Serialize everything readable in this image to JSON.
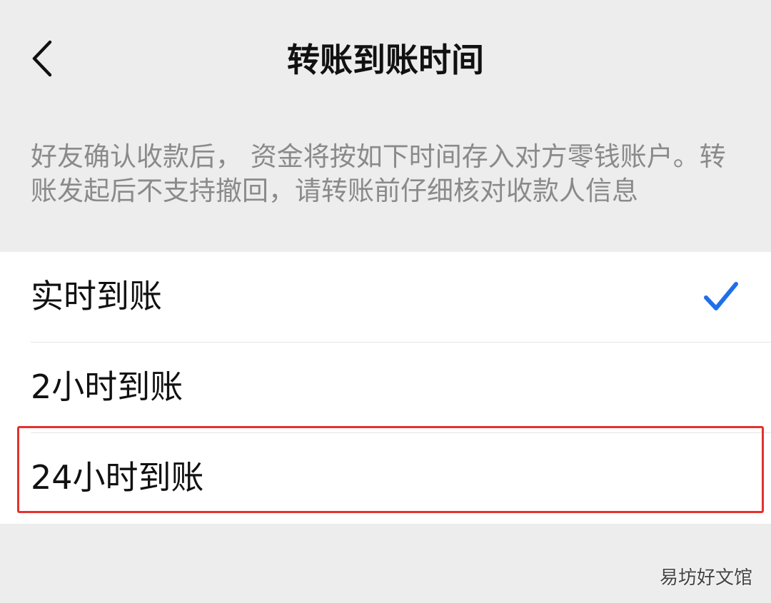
{
  "header": {
    "title": "转账到账时间",
    "back_icon": "chevron-left-icon"
  },
  "description": "好友确认收款后， 资金将按如下时间存入对方零钱账户。转账发起后不支持撤回，请转账前仔细核对收款人信息",
  "options": [
    {
      "label": "实时到账",
      "selected": true
    },
    {
      "label": "2小时到账",
      "selected": false
    },
    {
      "label": "24小时到账",
      "selected": false
    }
  ],
  "check_icon": "checkmark-icon",
  "colors": {
    "accent": "#1f6feb",
    "background": "#ededed",
    "highlight": "#e4322b"
  },
  "watermark": "易坊好文馆"
}
